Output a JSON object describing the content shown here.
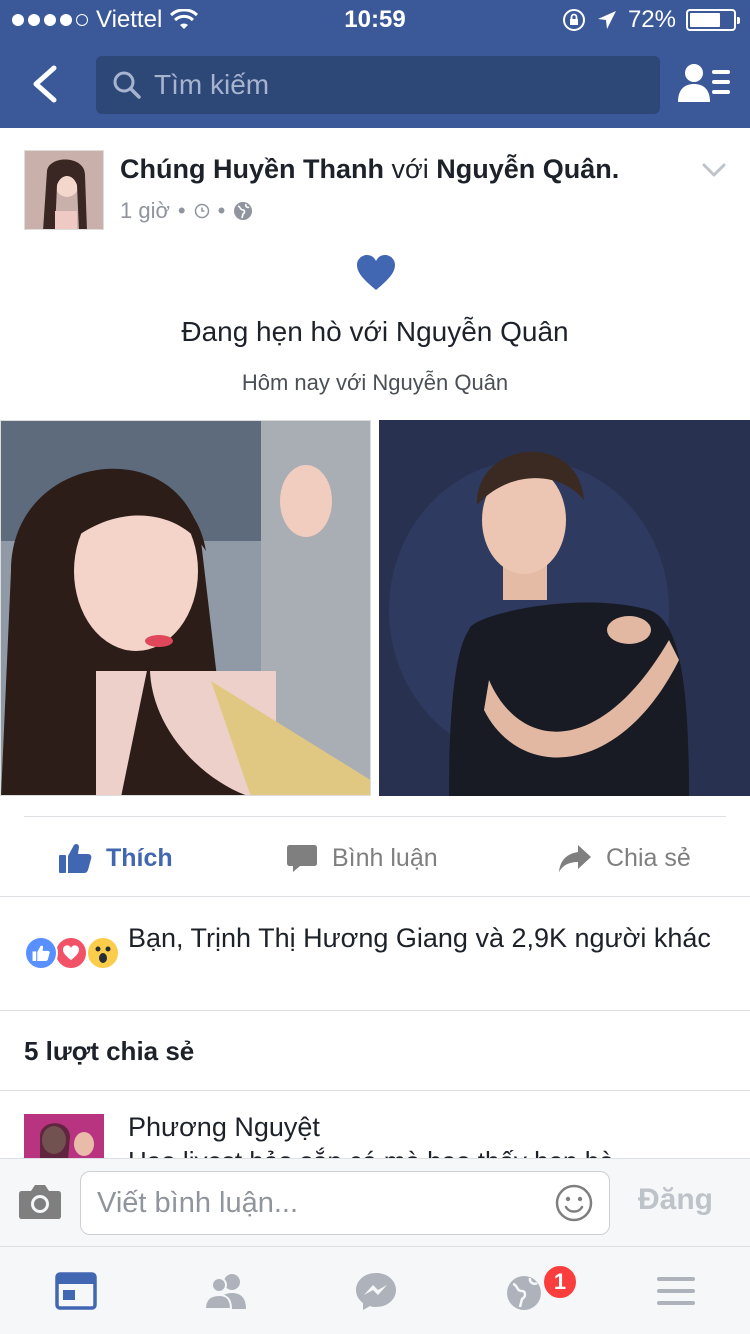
{
  "status_bar": {
    "carrier": "Viettel",
    "signal_bars": 4,
    "time": "10:59",
    "battery_percent_label": "72%",
    "battery_level": 0.72
  },
  "header": {
    "search_placeholder": "Tìm kiếm",
    "back_icon": "chevron-left-icon",
    "friends_icon": "friend-list-icon"
  },
  "post": {
    "author": "Chúng Huyền Thanh",
    "with_word": "với",
    "tagged": "Nguyễn Quân.",
    "time_ago": "1 giờ",
    "meta_sep": "•",
    "life_event_title": "Đang hẹn hò với Nguyễn Quân",
    "life_event_subtitle": "Hôm nay với Nguyễn Quân"
  },
  "actions": {
    "like": "Thích",
    "comment": "Bình luận",
    "share": "Chia sẻ"
  },
  "reactions": {
    "text": "Bạn, Trịnh Thị Hương Giang và 2,9K người khác",
    "types": [
      "like",
      "love",
      "wow"
    ]
  },
  "shares": {
    "text": "5 lượt chia sẻ"
  },
  "comment_preview": {
    "name": "Phương Nguyệt",
    "text": "Hạo livest bảo sắp có mà hạo thấy hẹn hò"
  },
  "composer": {
    "placeholder": "Viết bình luận...",
    "post_button": "Đăng"
  },
  "tabbar": {
    "notifications_badge": "1"
  },
  "colors": {
    "brand_blue": "#3b5998",
    "like_blue": "#4267b2",
    "badge_red": "#fa3e3e"
  }
}
